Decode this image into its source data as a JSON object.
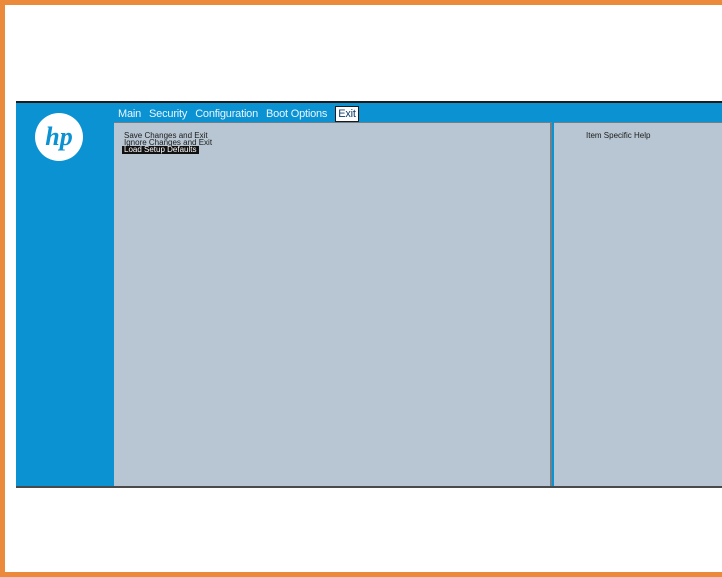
{
  "menu": {
    "items": [
      "Main",
      "Security",
      "Configuration",
      "Boot Options",
      "Exit"
    ],
    "active_index": 4
  },
  "exit_menu": {
    "options": [
      "Save Changes and Exit",
      "Ignore Changes and Exit",
      "Load Setup Defaults"
    ],
    "selected_index": 2
  },
  "help_panel": {
    "title": "Item Specific Help"
  },
  "colors": {
    "frame_border": "#ec8a3b",
    "bios_background": "#0a92d3",
    "panel_background": "#b7c6d2",
    "selected_option_background": "#111111"
  },
  "icons": {
    "logo": "hp-logo"
  }
}
